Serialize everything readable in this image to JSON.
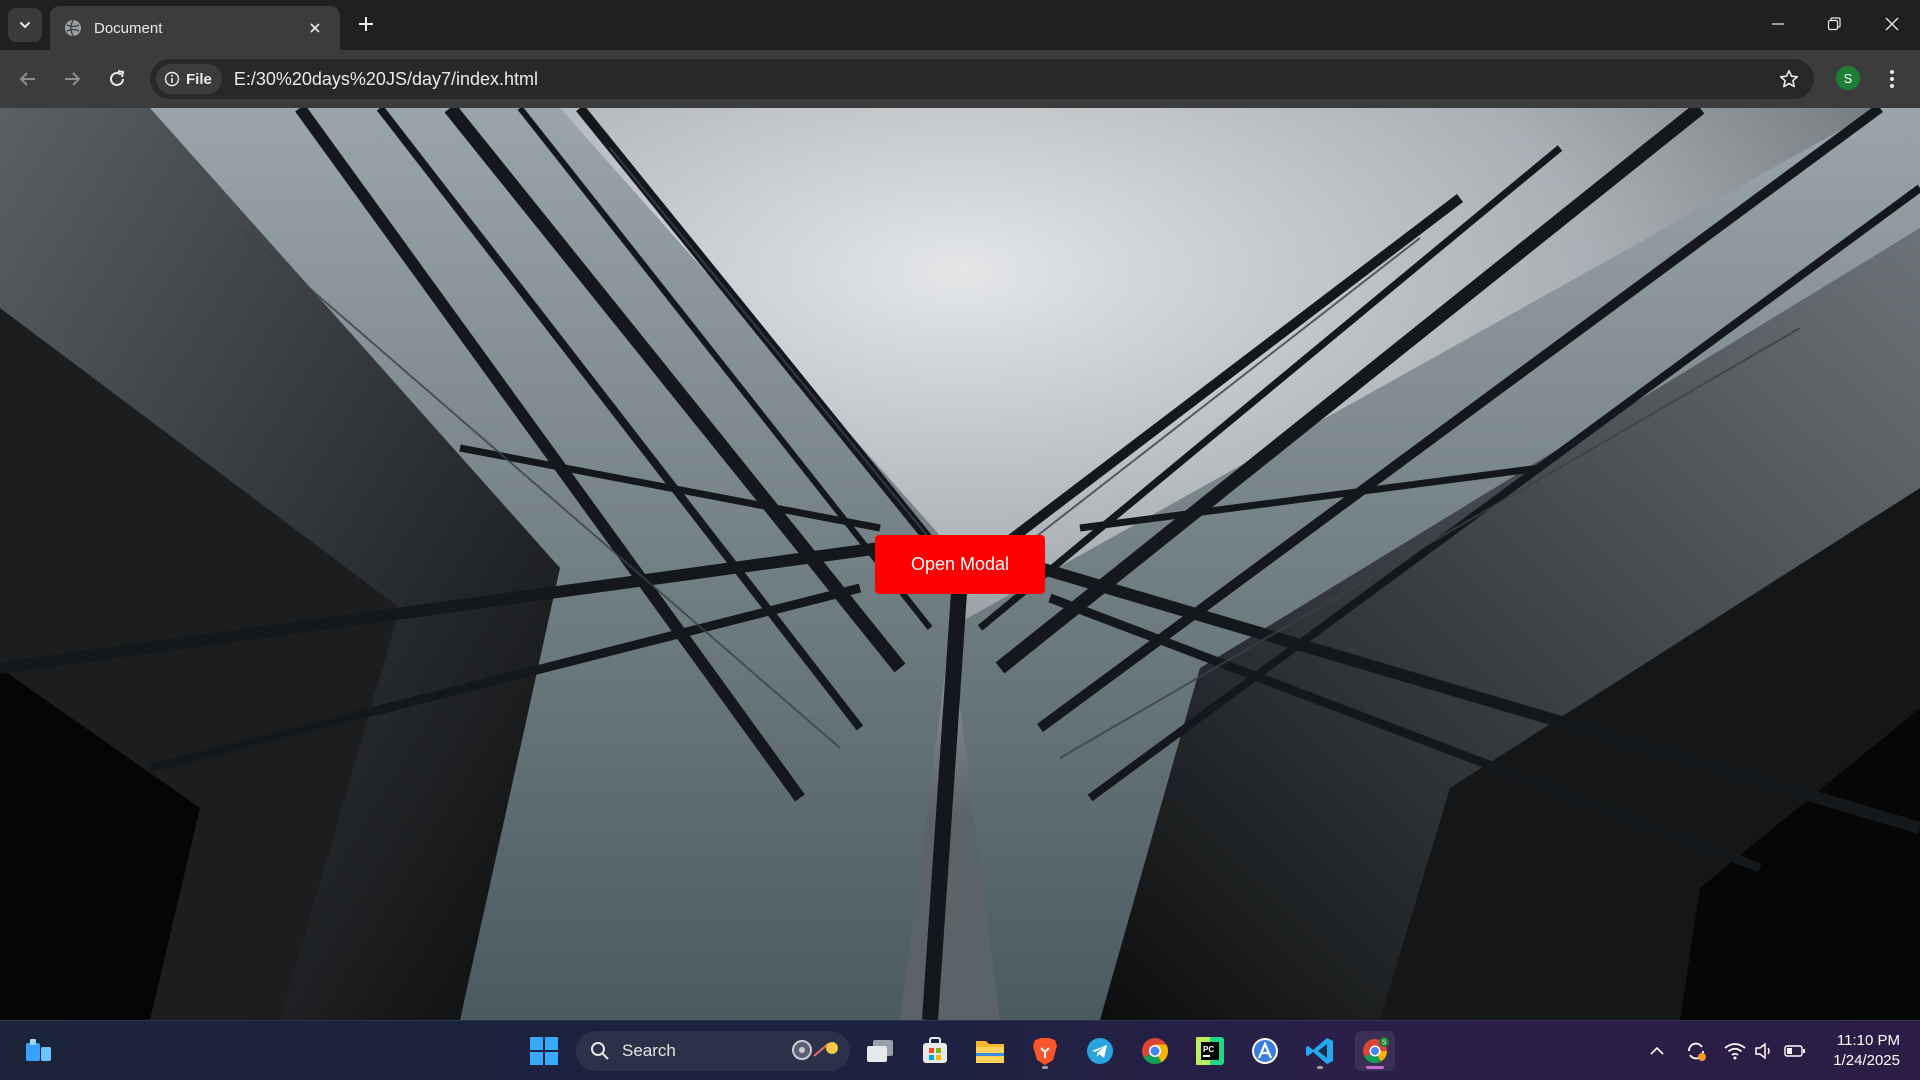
{
  "browser": {
    "tab": {
      "title": "Document"
    },
    "address_bar": {
      "chip_label": "File",
      "url": "E:/30%20days%20JS/day7/index.html"
    },
    "profile_initial": "S"
  },
  "page": {
    "open_modal_button": {
      "label": "Open Modal",
      "bg_color": "#ff0000",
      "text_color": "#ffffff"
    }
  },
  "taskbar": {
    "search_label": "Search",
    "apps": [
      "file-explorer-icon",
      "microsoft-store-icon",
      "folder-icon",
      "brave-icon",
      "telegram-icon",
      "chrome-icon",
      "pycharm-icon",
      "app-icon",
      "vscode-icon",
      "chrome-profile-icon"
    ],
    "clock": {
      "time": "11:10 PM",
      "date": "1/24/2025"
    }
  }
}
